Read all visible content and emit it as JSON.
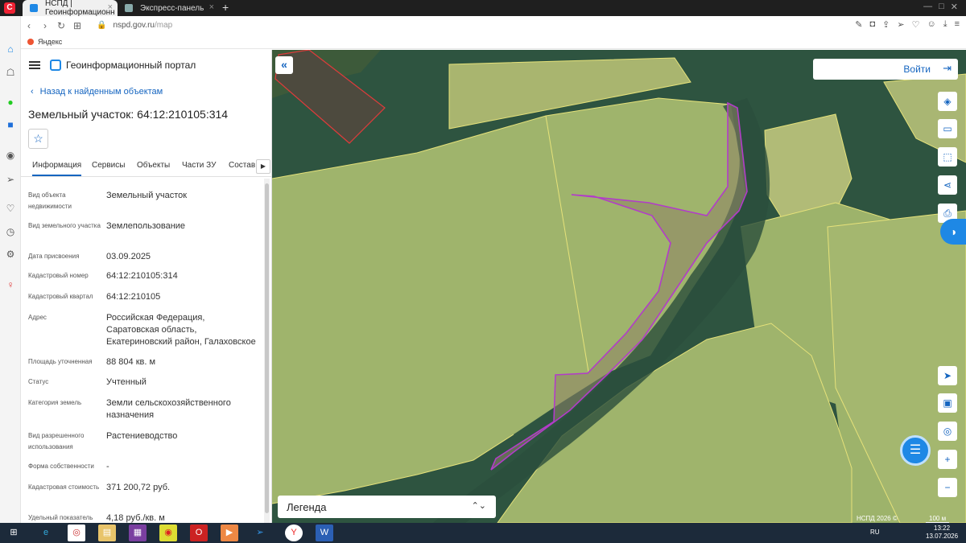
{
  "browser": {
    "tabs": [
      {
        "label": "НСПД | Геоинформационн",
        "active": true
      },
      {
        "label": "Экспресс-панель",
        "active": false
      }
    ],
    "url_domain": "nspd.gov.ru",
    "url_path": "/map",
    "bookmark": "Яндекс"
  },
  "portal": {
    "title": "Геоинформационный портал",
    "back_label": "Назад к найденным объектам",
    "object_title": "Земельный участок: 64:12:210105:314",
    "tabs": [
      "Информация",
      "Сервисы",
      "Объекты",
      "Части ЗУ",
      "Состав"
    ],
    "fields": [
      {
        "label": "Вид объекта недвижимости",
        "value": "Земельный участок"
      },
      {
        "label": "Вид земельного участка",
        "value": "Землепользование"
      },
      {
        "label": "Дата присвоения",
        "value": "03.09.2025"
      },
      {
        "label": "Кадастровый номер",
        "value": "64:12:210105:314"
      },
      {
        "label": "Кадастровый квартал",
        "value": "64:12:210105"
      },
      {
        "label": "Адрес",
        "value": "Российская Федерация, Саратовская область, Екатериновский район, Галаховское"
      },
      {
        "label": "Площадь уточненная",
        "value": "88 804 кв. м"
      },
      {
        "label": "Статус",
        "value": "Учтенный"
      },
      {
        "label": "Категория земель",
        "value": "Земли сельскохозяйственного назначения"
      },
      {
        "label": "Вид разрешенного использования",
        "value": "Растениеводство"
      },
      {
        "label": "Форма собственности",
        "value": "-"
      },
      {
        "label": "Кадастровая стоимость",
        "value": "371 200,72 руб."
      },
      {
        "label": "Удельный показатель",
        "value": "4,18 руб./кв. м"
      }
    ]
  },
  "map": {
    "login_label": "Войти",
    "legend_label": "Легенда",
    "attribution": "НСПД 2026 ©",
    "scale": "100 м",
    "colors": {
      "field": "#a6b96a",
      "parcel_outline": "#b23cc9",
      "boundary": "#e6e27a",
      "river": "#2f5a45"
    }
  },
  "taskbar": {
    "lang": "RU",
    "time": "13:22",
    "date": "13.07.2026"
  }
}
